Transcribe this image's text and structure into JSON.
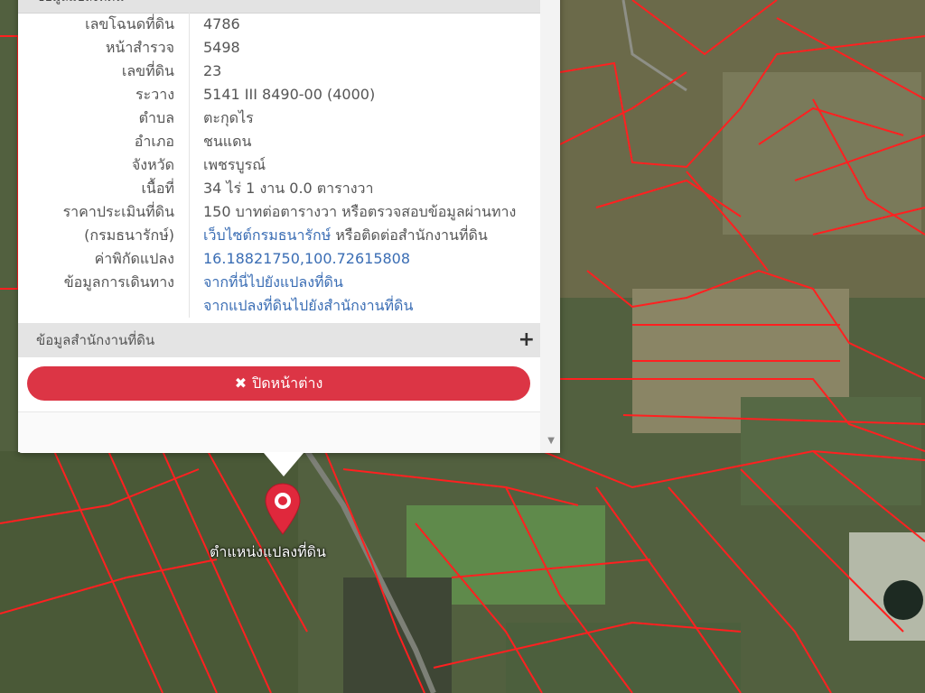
{
  "popup": {
    "header": "ข้อมูลแปลงที่ดิน",
    "rows": [
      {
        "key": "เลขโฉนดที่ดิน",
        "value": "4786"
      },
      {
        "key": "หน้าสำรวจ",
        "value": "5498"
      },
      {
        "key": "เลขที่ดิน",
        "value": "23"
      },
      {
        "key": "ระวาง",
        "value": "5141 III 8490-00 (4000)"
      },
      {
        "key": "ตำบล",
        "value": "ตะกุดไร"
      },
      {
        "key": "อำเภอ",
        "value": "ชนแดน"
      },
      {
        "key": "จังหวัด",
        "value": "เพชรบูรณ์"
      },
      {
        "key": "เนื้อที่",
        "value": "34 ไร่ 1 งาน 0.0 ตารางวา"
      },
      {
        "key": "ราคาประเมินที่ดิน",
        "value": "150 บาทต่อตารางวา หรือตรวจสอบข้อมูลผ่านทาง"
      },
      {
        "key": "(กรมธนารักษ์)",
        "value_link": "เว็บไซต์กรมธนารักษ์",
        "value_suffix": " หรือติดต่อสำนักงานที่ดิน"
      },
      {
        "key": "ค่าพิกัดแปลง",
        "value_link": "16.18821750,100.72615808"
      },
      {
        "key": "ข้อมูลการเดินทาง",
        "value_link": "จากที่นี่ไปยังแปลงที่ดิน"
      },
      {
        "key": "",
        "value_link": "จากแปลงที่ดินไปยังสำนักงานที่ดิน"
      }
    ],
    "section_label": "ข้อมูลสำนักงานที่ดิน",
    "section_icon": "plus-icon",
    "close_label": "ปิดหน้าต่าง",
    "close_icon": "times-icon"
  },
  "map": {
    "marker_label": "ตำแหน่งแปลงที่ดิน",
    "marker_color": "#e0283c",
    "parcel_line_color": "#ff2020"
  }
}
